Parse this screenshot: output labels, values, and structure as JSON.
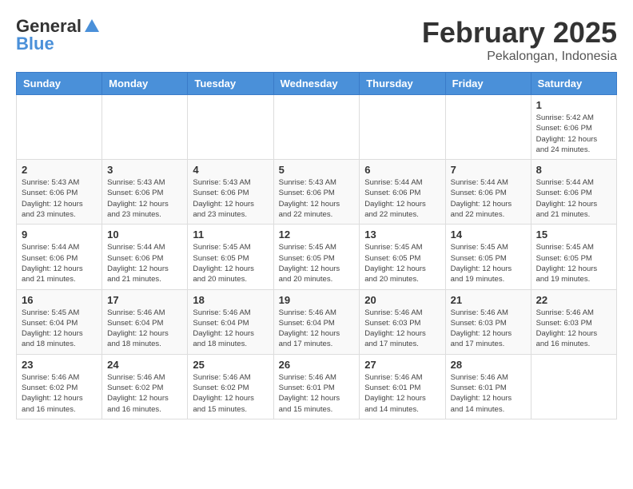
{
  "logo": {
    "part1": "General",
    "part2": "Blue"
  },
  "title": {
    "month_year": "February 2025",
    "location": "Pekalongan, Indonesia"
  },
  "weekdays": [
    "Sunday",
    "Monday",
    "Tuesday",
    "Wednesday",
    "Thursday",
    "Friday",
    "Saturday"
  ],
  "weeks": [
    [
      {
        "day": "",
        "info": ""
      },
      {
        "day": "",
        "info": ""
      },
      {
        "day": "",
        "info": ""
      },
      {
        "day": "",
        "info": ""
      },
      {
        "day": "",
        "info": ""
      },
      {
        "day": "",
        "info": ""
      },
      {
        "day": "1",
        "info": "Sunrise: 5:42 AM\nSunset: 6:06 PM\nDaylight: 12 hours\nand 24 minutes."
      }
    ],
    [
      {
        "day": "2",
        "info": "Sunrise: 5:43 AM\nSunset: 6:06 PM\nDaylight: 12 hours\nand 23 minutes."
      },
      {
        "day": "3",
        "info": "Sunrise: 5:43 AM\nSunset: 6:06 PM\nDaylight: 12 hours\nand 23 minutes."
      },
      {
        "day": "4",
        "info": "Sunrise: 5:43 AM\nSunset: 6:06 PM\nDaylight: 12 hours\nand 23 minutes."
      },
      {
        "day": "5",
        "info": "Sunrise: 5:43 AM\nSunset: 6:06 PM\nDaylight: 12 hours\nand 22 minutes."
      },
      {
        "day": "6",
        "info": "Sunrise: 5:44 AM\nSunset: 6:06 PM\nDaylight: 12 hours\nand 22 minutes."
      },
      {
        "day": "7",
        "info": "Sunrise: 5:44 AM\nSunset: 6:06 PM\nDaylight: 12 hours\nand 22 minutes."
      },
      {
        "day": "8",
        "info": "Sunrise: 5:44 AM\nSunset: 6:06 PM\nDaylight: 12 hours\nand 21 minutes."
      }
    ],
    [
      {
        "day": "9",
        "info": "Sunrise: 5:44 AM\nSunset: 6:06 PM\nDaylight: 12 hours\nand 21 minutes."
      },
      {
        "day": "10",
        "info": "Sunrise: 5:44 AM\nSunset: 6:06 PM\nDaylight: 12 hours\nand 21 minutes."
      },
      {
        "day": "11",
        "info": "Sunrise: 5:45 AM\nSunset: 6:05 PM\nDaylight: 12 hours\nand 20 minutes."
      },
      {
        "day": "12",
        "info": "Sunrise: 5:45 AM\nSunset: 6:05 PM\nDaylight: 12 hours\nand 20 minutes."
      },
      {
        "day": "13",
        "info": "Sunrise: 5:45 AM\nSunset: 6:05 PM\nDaylight: 12 hours\nand 20 minutes."
      },
      {
        "day": "14",
        "info": "Sunrise: 5:45 AM\nSunset: 6:05 PM\nDaylight: 12 hours\nand 19 minutes."
      },
      {
        "day": "15",
        "info": "Sunrise: 5:45 AM\nSunset: 6:05 PM\nDaylight: 12 hours\nand 19 minutes."
      }
    ],
    [
      {
        "day": "16",
        "info": "Sunrise: 5:45 AM\nSunset: 6:04 PM\nDaylight: 12 hours\nand 18 minutes."
      },
      {
        "day": "17",
        "info": "Sunrise: 5:46 AM\nSunset: 6:04 PM\nDaylight: 12 hours\nand 18 minutes."
      },
      {
        "day": "18",
        "info": "Sunrise: 5:46 AM\nSunset: 6:04 PM\nDaylight: 12 hours\nand 18 minutes."
      },
      {
        "day": "19",
        "info": "Sunrise: 5:46 AM\nSunset: 6:04 PM\nDaylight: 12 hours\nand 17 minutes."
      },
      {
        "day": "20",
        "info": "Sunrise: 5:46 AM\nSunset: 6:03 PM\nDaylight: 12 hours\nand 17 minutes."
      },
      {
        "day": "21",
        "info": "Sunrise: 5:46 AM\nSunset: 6:03 PM\nDaylight: 12 hours\nand 17 minutes."
      },
      {
        "day": "22",
        "info": "Sunrise: 5:46 AM\nSunset: 6:03 PM\nDaylight: 12 hours\nand 16 minutes."
      }
    ],
    [
      {
        "day": "23",
        "info": "Sunrise: 5:46 AM\nSunset: 6:02 PM\nDaylight: 12 hours\nand 16 minutes."
      },
      {
        "day": "24",
        "info": "Sunrise: 5:46 AM\nSunset: 6:02 PM\nDaylight: 12 hours\nand 16 minutes."
      },
      {
        "day": "25",
        "info": "Sunrise: 5:46 AM\nSunset: 6:02 PM\nDaylight: 12 hours\nand 15 minutes."
      },
      {
        "day": "26",
        "info": "Sunrise: 5:46 AM\nSunset: 6:01 PM\nDaylight: 12 hours\nand 15 minutes."
      },
      {
        "day": "27",
        "info": "Sunrise: 5:46 AM\nSunset: 6:01 PM\nDaylight: 12 hours\nand 14 minutes."
      },
      {
        "day": "28",
        "info": "Sunrise: 5:46 AM\nSunset: 6:01 PM\nDaylight: 12 hours\nand 14 minutes."
      },
      {
        "day": "",
        "info": ""
      }
    ]
  ]
}
